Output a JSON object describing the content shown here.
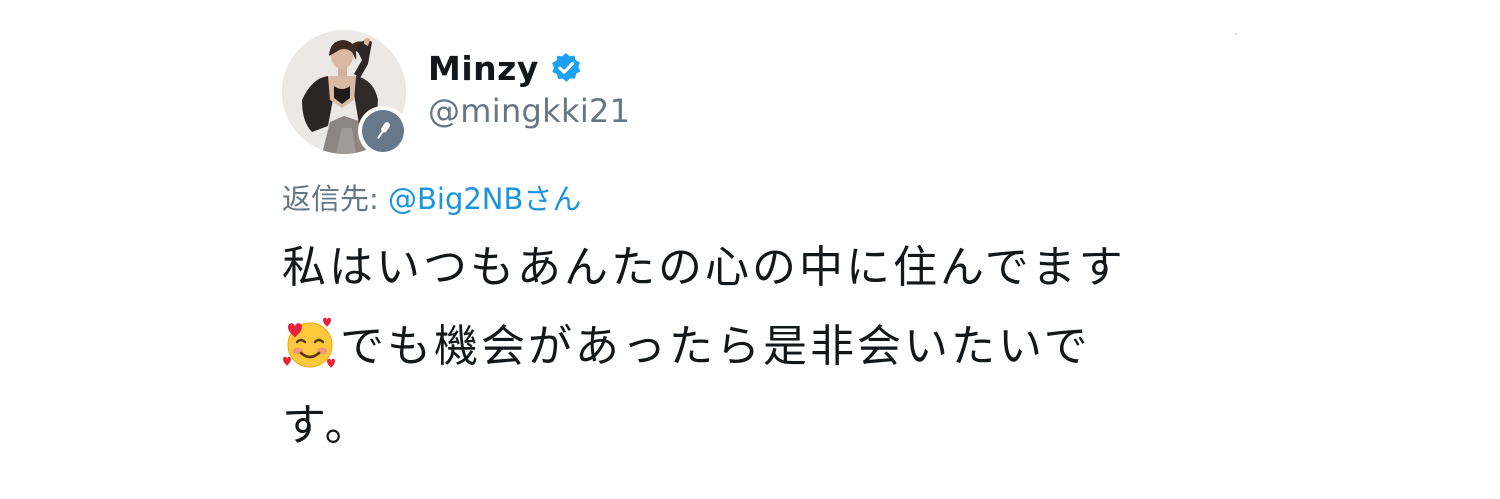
{
  "user": {
    "display_name": "Minzy",
    "handle": "@mingkki21",
    "verified": true,
    "avatar": "profile-photo",
    "avatar_badge_icon": "microphone-icon"
  },
  "reply": {
    "prefix": "返信先: ",
    "target": "@Big2NBさん"
  },
  "tweet": {
    "line1": "私はいつもあんたの心の中に住んでます",
    "line2_emoji": "smiling-face-with-hearts-emoji",
    "line2_text": "でも機会があったら是非会いたいで",
    "line3": "す。"
  },
  "colors": {
    "verified_blue": "#1da1f2",
    "link_blue": "#1b95e0",
    "muted_gray": "#657786",
    "text_dark": "#14171a",
    "badge_gray": "#67788a"
  }
}
